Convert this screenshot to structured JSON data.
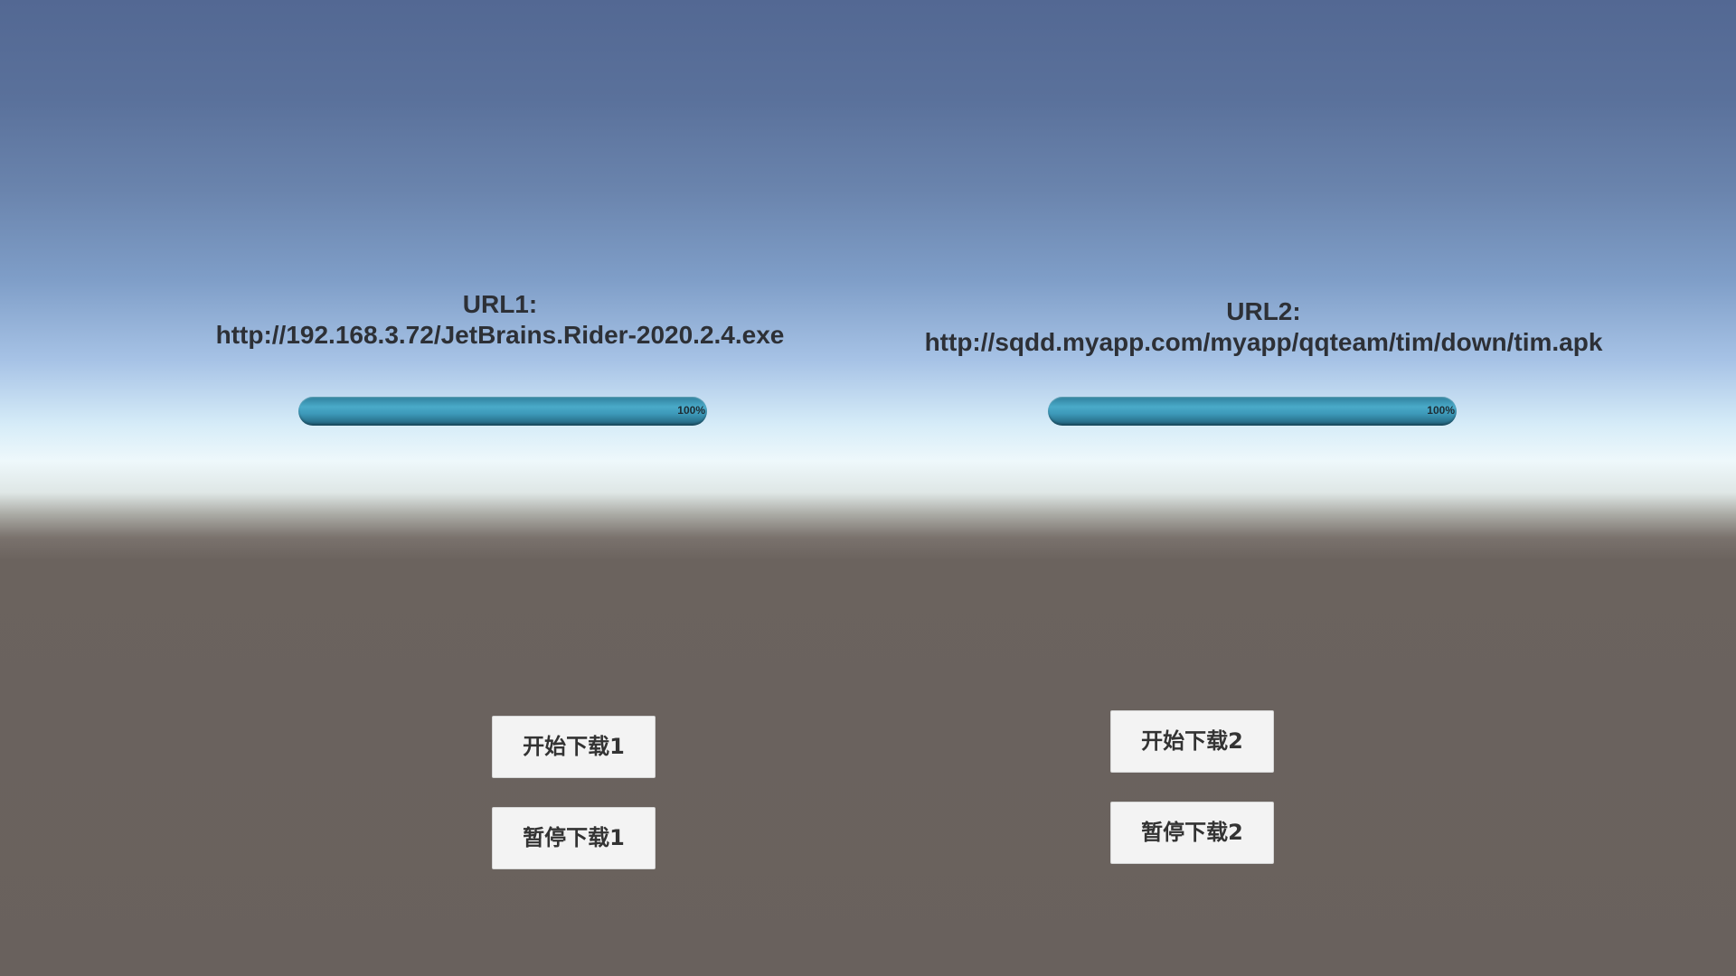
{
  "downloads": [
    {
      "label": "URL1:",
      "url": "http://192.168.3.72/JetBrains.Rider-2020.2.4.exe",
      "progress_percent": 100,
      "progress_text": "100%",
      "start_label": "开始下载1",
      "pause_label": "暂停下载1"
    },
    {
      "label": "URL2:",
      "url": "http://sqdd.myapp.com/myapp/qqteam/tim/down/tim.apk",
      "progress_percent": 100,
      "progress_text": "100%",
      "start_label": "开始下载2",
      "pause_label": "暂停下载2"
    }
  ],
  "colors": {
    "progress_bar": "#3c98b8",
    "button_bg": "#f3f3f3",
    "text": "#2d3036",
    "ground": "#69615d"
  }
}
